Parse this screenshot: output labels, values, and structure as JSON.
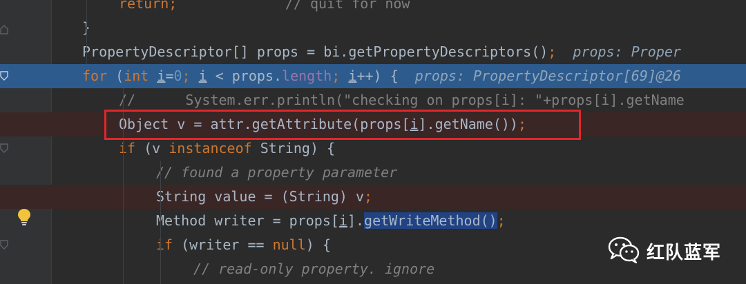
{
  "editor": {
    "lines": [
      {
        "id": "return",
        "segments": [
          {
            "t": "return",
            "c": "kw"
          },
          {
            "t": ";",
            "c": "kw"
          },
          {
            "t": "             // quit for now",
            "c": "cm"
          }
        ]
      },
      {
        "id": "close-brace",
        "segments": [
          {
            "t": "}",
            "c": ""
          }
        ]
      },
      {
        "id": "props-decl",
        "segments": [
          {
            "t": "PropertyDescriptor[] props = bi.getPropertyDescriptors()",
            "c": ""
          },
          {
            "t": ";",
            "c": "kw"
          },
          {
            "t": "  props: Proper",
            "c": "hint"
          }
        ]
      },
      {
        "id": "for-loop",
        "segments": [
          {
            "t": "for",
            "c": "kw"
          },
          {
            "t": " (",
            "c": ""
          },
          {
            "t": "int",
            "c": "kw"
          },
          {
            "t": " ",
            "c": ""
          },
          {
            "t": "i",
            "c": "ul"
          },
          {
            "t": "=",
            "c": ""
          },
          {
            "t": "0",
            "c": "num"
          },
          {
            "t": "; ",
            "c": "kw"
          },
          {
            "t": "i",
            "c": "ul"
          },
          {
            "t": " < props.",
            "c": ""
          },
          {
            "t": "length",
            "c": "fld"
          },
          {
            "t": "; ",
            "c": "kw"
          },
          {
            "t": "i",
            "c": "ul"
          },
          {
            "t": "++) {",
            "c": ""
          },
          {
            "t": "  props: PropertyDescriptor[69]@26",
            "c": "hint"
          }
        ]
      },
      {
        "id": "comment-println",
        "segments": [
          {
            "t": "//      System.err.println(\"checking on props[i]: \"+props[i].getName",
            "c": "cm"
          }
        ]
      },
      {
        "id": "object-v",
        "segments": [
          {
            "t": "Object v = attr.getAttribute(props[",
            "c": ""
          },
          {
            "t": "i",
            "c": "ul"
          },
          {
            "t": "].getName())",
            "c": ""
          },
          {
            "t": ";",
            "c": "kw"
          }
        ]
      },
      {
        "id": "if-instanceof",
        "segments": [
          {
            "t": "if",
            "c": "kw"
          },
          {
            "t": " (v ",
            "c": ""
          },
          {
            "t": "instanceof",
            "c": "kw"
          },
          {
            "t": " String) {",
            "c": ""
          }
        ]
      },
      {
        "id": "comment-found",
        "segments": [
          {
            "t": "// found a property parameter",
            "c": "ci"
          }
        ]
      },
      {
        "id": "string-value",
        "segments": [
          {
            "t": "String value = (String) v",
            "c": ""
          },
          {
            "t": ";",
            "c": "kw"
          }
        ]
      },
      {
        "id": "method-writer",
        "segments": [
          {
            "t": "Method writer = props[",
            "c": ""
          },
          {
            "t": "i",
            "c": "ul"
          },
          {
            "t": "].",
            "c": ""
          },
          {
            "t": "getWriteMethod()",
            "c": "sel"
          },
          {
            "t": ";",
            "c": "kw"
          }
        ]
      },
      {
        "id": "if-writer",
        "segments": [
          {
            "t": "if",
            "c": "kw"
          },
          {
            "t": " (writer == ",
            "c": ""
          },
          {
            "t": "null",
            "c": "kw"
          },
          {
            "t": ") {",
            "c": ""
          }
        ]
      },
      {
        "id": "comment-readonly",
        "segments": [
          {
            "t": "// read-only property. ignore",
            "c": "ci"
          }
        ]
      }
    ]
  },
  "watermark": {
    "text": "红队蓝军",
    "icon": "wechat-icon"
  },
  "colors": {
    "background": "#2b2b2b",
    "execution_line": "#2d5b8e",
    "breakpoint_line": "#3b2626",
    "keyword": "#cc7832",
    "number": "#6897bb",
    "comment": "#808080",
    "field": "#9876aa",
    "highlight_box": "#e0272c"
  }
}
